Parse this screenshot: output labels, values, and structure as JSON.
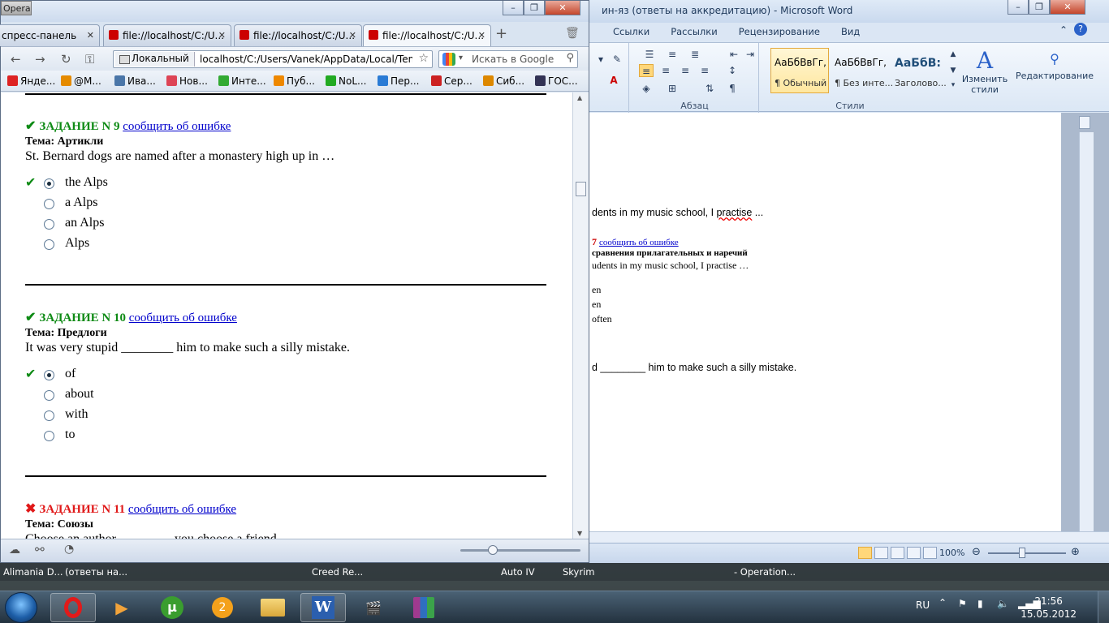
{
  "word": {
    "title": "ин-яз (ответы на аккредитацию)  -  Microsoft Word",
    "tabs": [
      "Ссылки",
      "Рассылки",
      "Рецензирование",
      "Вид"
    ],
    "groups": {
      "paragraph": "Абзац",
      "styles": "Стили"
    },
    "styles": [
      {
        "sample": "АаБбВвГг,",
        "name": "¶ Обычный"
      },
      {
        "sample": "АаБбВвГг,",
        "name": "¶ Без инте..."
      },
      {
        "sample": "АаБбВ:",
        "name": "Заголово..."
      }
    ],
    "change_styles": "Изменить стили",
    "editing": "Редактирование",
    "doc": {
      "line1_a": "dents in my music school, I ",
      "line1_b": "practise",
      "line1_c": " ...",
      "num": "7",
      "link": "сообщить об ошибке",
      "topic": "сравнения прилагательных и наречий",
      "line2": "udents in my music school, I practise …",
      "opt1": "en",
      "opt2": "en",
      "opt3": " often",
      "line3": "d ________ him to make such a silly mistake."
    },
    "zoom": "100%"
  },
  "opera": {
    "app_label": "Opera",
    "tabs": [
      {
        "label": "спресс-панель"
      },
      {
        "label": "file://localhost/C:/U..."
      },
      {
        "label": "file://localhost/C:/U..."
      },
      {
        "label": "file://localhost/C:/U..."
      }
    ],
    "address": {
      "badge": "Локальный",
      "url": "localhost/C:/Users/Vanek/AppData/Local/Temp/l"
    },
    "search_placeholder": "Искать в Google",
    "bookmarks": [
      {
        "label": "Янде...",
        "color": "#d22"
      },
      {
        "label": "@M...",
        "color": "#e58b00"
      },
      {
        "label": "Ива...",
        "color": "#4a76a8"
      },
      {
        "label": "Нов...",
        "color": "#d45"
      },
      {
        "label": "Инте...",
        "color": "#3a3"
      },
      {
        "label": "Пуб...",
        "color": "#e80"
      },
      {
        "label": "NoL...",
        "color": "#2a2"
      },
      {
        "label": "Пер...",
        "color": "#2a7bd5"
      },
      {
        "label": "Сер...",
        "color": "#c22"
      },
      {
        "label": "Сиб...",
        "color": "#d80"
      },
      {
        "label": "ГОС...",
        "color": "#335"
      }
    ],
    "questions": [
      {
        "status": "correct",
        "title": "ЗАДАНИЕ N 9",
        "link": "сообщить об ошибке",
        "topic": "Тема: Артикли",
        "text": "St. Bernard dogs are named after a monastery high up in …",
        "options": [
          "the Alps",
          "a Alps",
          "an Alps",
          "Alps"
        ],
        "selected": 0
      },
      {
        "status": "correct",
        "title": "ЗАДАНИЕ N 10",
        "link": "сообщить об ошибке",
        "topic": "Тема: Предлоги",
        "text": "It was very stupid ________ him to make such a silly mistake.",
        "options": [
          "of",
          "about",
          "with",
          "to"
        ],
        "selected": 0
      },
      {
        "status": "wrong",
        "title": "ЗАДАНИЕ N 11",
        "link": "сообщить об ошибке",
        "topic": "Тема: Союзы",
        "text": "Choose an author ________ you choose a friend."
      }
    ]
  },
  "taskbar": {
    "mini_windows": [
      "Alimania D...",
      "(ответы на...",
      "Creed Re...",
      "Auto IV",
      "Skyrim",
      "- Operation..."
    ],
    "lang": "RU",
    "time": "21:56",
    "date": "15.05.2012"
  },
  "colors": {
    "correct": "#0d8a14",
    "wrong": "#e01818",
    "link": "#0000cc"
  }
}
